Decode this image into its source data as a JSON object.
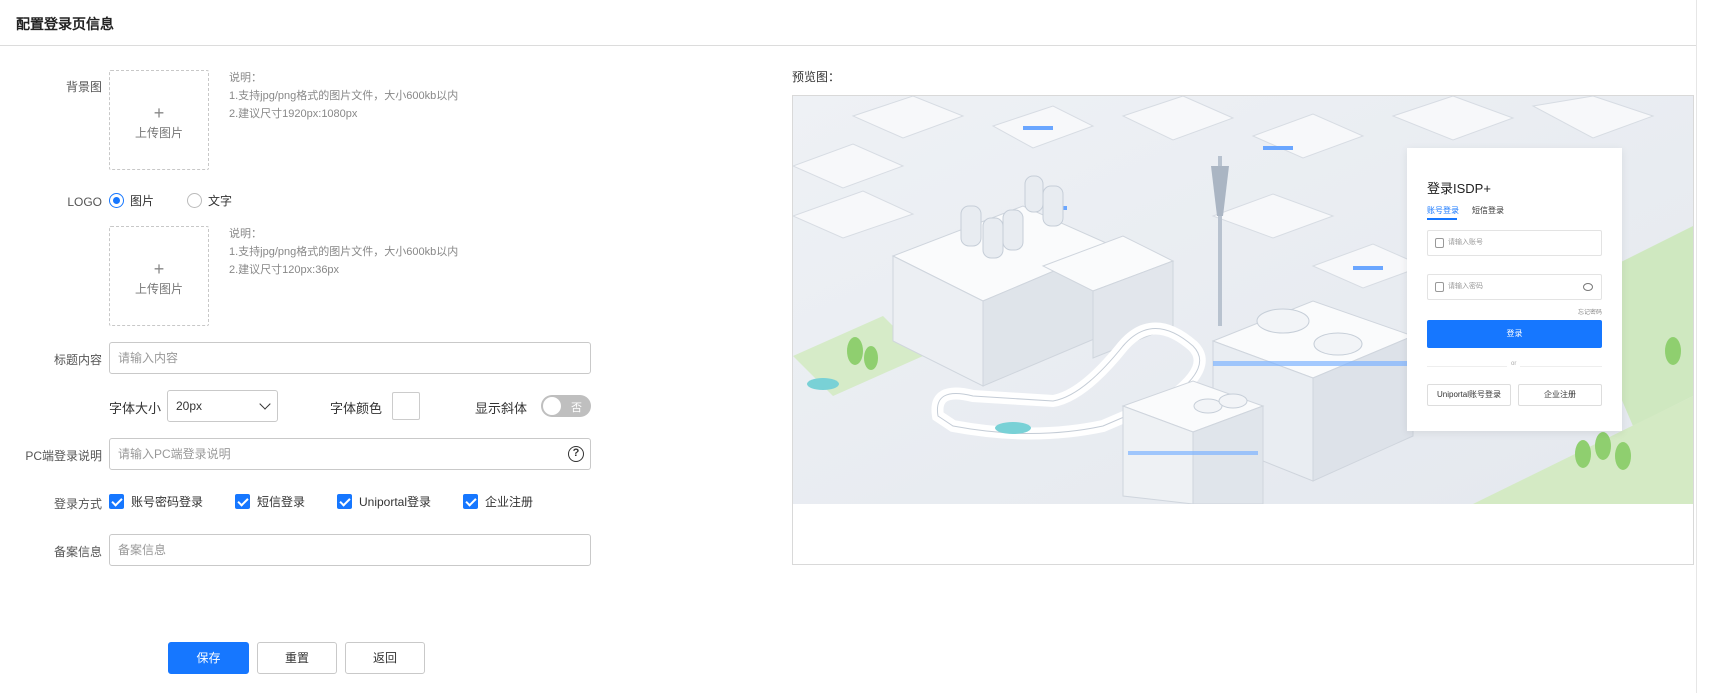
{
  "header": {
    "title": "配置登录页信息"
  },
  "form": {
    "background": {
      "label": "背景图",
      "upload_label": "上传图片",
      "note_title": "说明：",
      "note_1": "1.支持jpg/png格式的图片文件，大小600kb以内",
      "note_2": "2.建议尺寸1920px:1080px"
    },
    "logo": {
      "label": "LOGO",
      "option_image": "图片",
      "option_text": "文字",
      "selected": "图片",
      "upload_label": "上传图片",
      "note_title": "说明：",
      "note_1": "1.支持jpg/png格式的图片文件，大小600kb以内",
      "note_2": "2.建议尺寸120px:36px"
    },
    "title_content": {
      "label": "标题内容",
      "placeholder": "请输入内容"
    },
    "font_size": {
      "label": "字体大小",
      "value": "20px"
    },
    "font_color": {
      "label": "字体颜色",
      "value": "#ffffff"
    },
    "italic": {
      "label": "显示斜体",
      "state": "否"
    },
    "pc_desc": {
      "label": "PC端登录说明",
      "placeholder": "请输入PC端登录说明"
    },
    "login_methods": {
      "label": "登录方式",
      "options": [
        "账号密码登录",
        "短信登录",
        "Uniportal登录",
        "企业注册"
      ]
    },
    "filing": {
      "label": "备案信息",
      "placeholder": "备案信息"
    }
  },
  "actions": {
    "save": "保存",
    "reset": "重置",
    "back": "返回"
  },
  "preview": {
    "label": "预览图：",
    "login_card": {
      "title": "登录ISDP+",
      "tab_account": "账号登录",
      "tab_sms": "短信登录",
      "account_placeholder": "请输入账号",
      "password_placeholder": "请输入密码",
      "forgot": "忘记密码",
      "login_button": "登录",
      "or": "or",
      "uniportal_button": "Uniportal账号登录",
      "register_button": "企业注册"
    }
  },
  "colors": {
    "primary": "#1677ff"
  }
}
